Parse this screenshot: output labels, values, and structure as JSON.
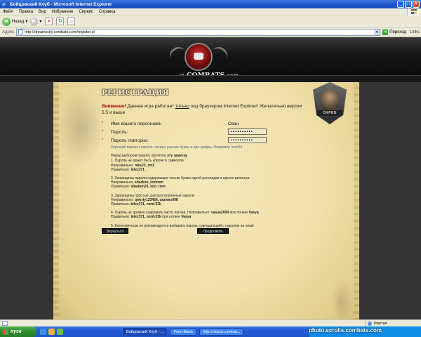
{
  "window": {
    "title": "Бойцовский Клуб - Microsoft Internet Explorer"
  },
  "menu": [
    "Файл",
    "Правка",
    "Вид",
    "Избранное",
    "Сервис",
    "Справка"
  ],
  "toolbar": {
    "back_label": "Назад"
  },
  "address": {
    "label": "Адрес",
    "url": "http://dreamscity.combats.com/register.pl",
    "go_label": "Переход",
    "links_label": "Links"
  },
  "site": {
    "logo_prefix": "™",
    "logo_text": "COMBATS",
    "logo_suffix": "com",
    "emblem_text": "ОХРЕБ"
  },
  "registration": {
    "heading": "РЕГИСТРАЦИЯ",
    "notice_warn": "Внимание!",
    "notice_part1": " Данная игра работает ",
    "notice_only": "только",
    "notice_part2": " под браузером Internet Explorer! Желательно версии 5.5 и выше.",
    "name_label": "Имя вашего персонажа:",
    "name_value": "Озан",
    "password_label": "Пароль:",
    "password_value": "••••••••••",
    "password_repeat_label": "Пароль повторно:",
    "password_repeat_value": "••••••••••",
    "star": "*",
    "hint": "Хороший вариант пароля: четыре разные буквы и две цифры. Например hero63",
    "rules_intro_1": "Перед выбором пароля, прочтите ",
    "rules_intro_bold": "эту заметку",
    "rule1_title": "1. Пароль не может быть короче 6 символов.",
    "rule1_bad_label": "Неправильно: ",
    "rule1_bad": "mks23, zm2",
    "rule1_good_label": "Правильно: ",
    "rule1_good": "telez371",
    "rule2_title": "2. Запрещены пароли содержащие только буквы одной раскладки и одного регистра.",
    "rule2_bad_label": "Неправильно: ",
    "rule2_bad": "sharkon, letotron",
    "rule2_good_label": "Правильно: ",
    "rule2_good": "sharkon25, leto_tron",
    "rule3_title": "3. Запрещены простые, распространенные пароли.",
    "rule3_bad_label": "Неправильно: ",
    "rule3_bad": "qwerty123456, qazwsx098",
    "rule3_good_label": "Правильно: ",
    "rule3_good": "telez371, nord-23k",
    "rule4_a": "4. Пароль не должен содержать части логина. Неправильно: ",
    "rule4_bad1": "vasya2004",
    "rule4_b": " при логине ",
    "rule4_login1": "Vasya",
    "rule4_c": "Правильно: ",
    "rule4_good": "telez371, nord-23k",
    "rule4_d": " при логине ",
    "rule4_login2": "Vasya",
    "rule5": "5. Категорически не рекомендуется выбирать пароль совпадающий с паролем на email.",
    "back_button": "Вернуться",
    "continue_button": "Продолжить"
  },
  "statusbar": {
    "zone": "Internet"
  },
  "taskbar": {
    "start": "пуск",
    "tasks": [
      "Бойцовский Клуб - ...",
      "Point Blank",
      "http://oldcity.combat..."
    ],
    "watermark": "photo.scrolls.combats.com"
  },
  "colors": {
    "title_bar": "#1c55c9",
    "warning": "#b00000",
    "parchment": "#efe0a8",
    "header_bg": "#141414"
  }
}
